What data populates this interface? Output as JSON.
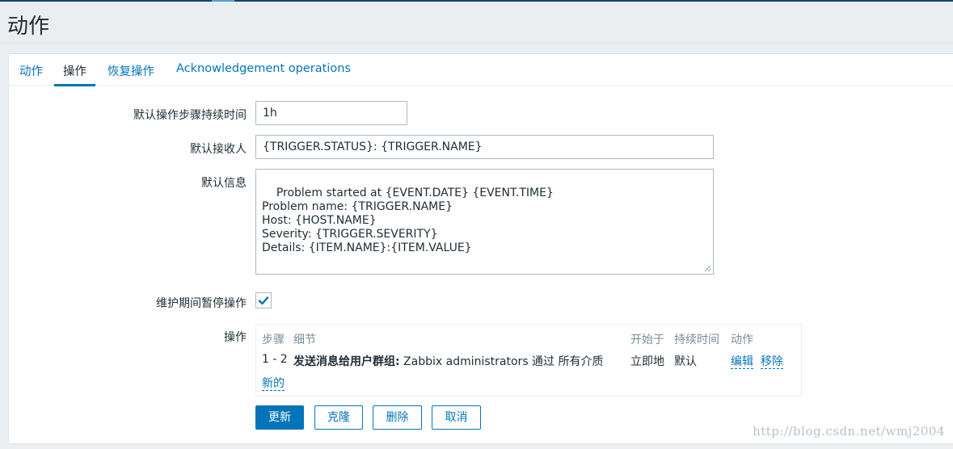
{
  "page": {
    "title": "动作"
  },
  "tabs": [
    {
      "label": "动作"
    },
    {
      "label": "操作"
    },
    {
      "label": "恢复操作"
    },
    {
      "label": "Acknowledgement operations"
    }
  ],
  "form": {
    "default_step_duration": {
      "label": "默认操作步骤持续时间",
      "value": "1h"
    },
    "default_subject": {
      "label": "默认接收人",
      "value": "{TRIGGER.STATUS}: {TRIGGER.NAME}"
    },
    "default_message": {
      "label": "默认信息",
      "value": "Problem started at {EVENT.DATE} {EVENT.TIME}\nProblem name: {TRIGGER.NAME}\nHost: {HOST.NAME}\nSeverity: {TRIGGER.SEVERITY}\nDetails: {ITEM.NAME}:{ITEM.VALUE}"
    },
    "pause_in_maintenance": {
      "label": "维护期间暂停操作",
      "checked": true
    },
    "operations": {
      "label": "操作",
      "headers": {
        "steps": "步骤",
        "details": "细节",
        "start_in": "开始于",
        "duration": "持续时间",
        "action": "动作"
      },
      "rows": [
        {
          "steps": "1 - 2",
          "details_bold": "发送消息给用户群组:",
          "details_rest": " Zabbix administrators 通过 所有介质",
          "start_in": "立即地",
          "duration": "默认",
          "edit": "编辑",
          "remove": "移除"
        }
      ],
      "new_link": "新的"
    }
  },
  "buttons": {
    "update": "更新",
    "clone": "克隆",
    "delete": "删除",
    "cancel": "取消"
  },
  "watermark": "http://blog.csdn.net/wmj2004",
  "colors": {
    "accent": "#0275b8",
    "text": "#1f2c33",
    "muted": "#768d99"
  }
}
